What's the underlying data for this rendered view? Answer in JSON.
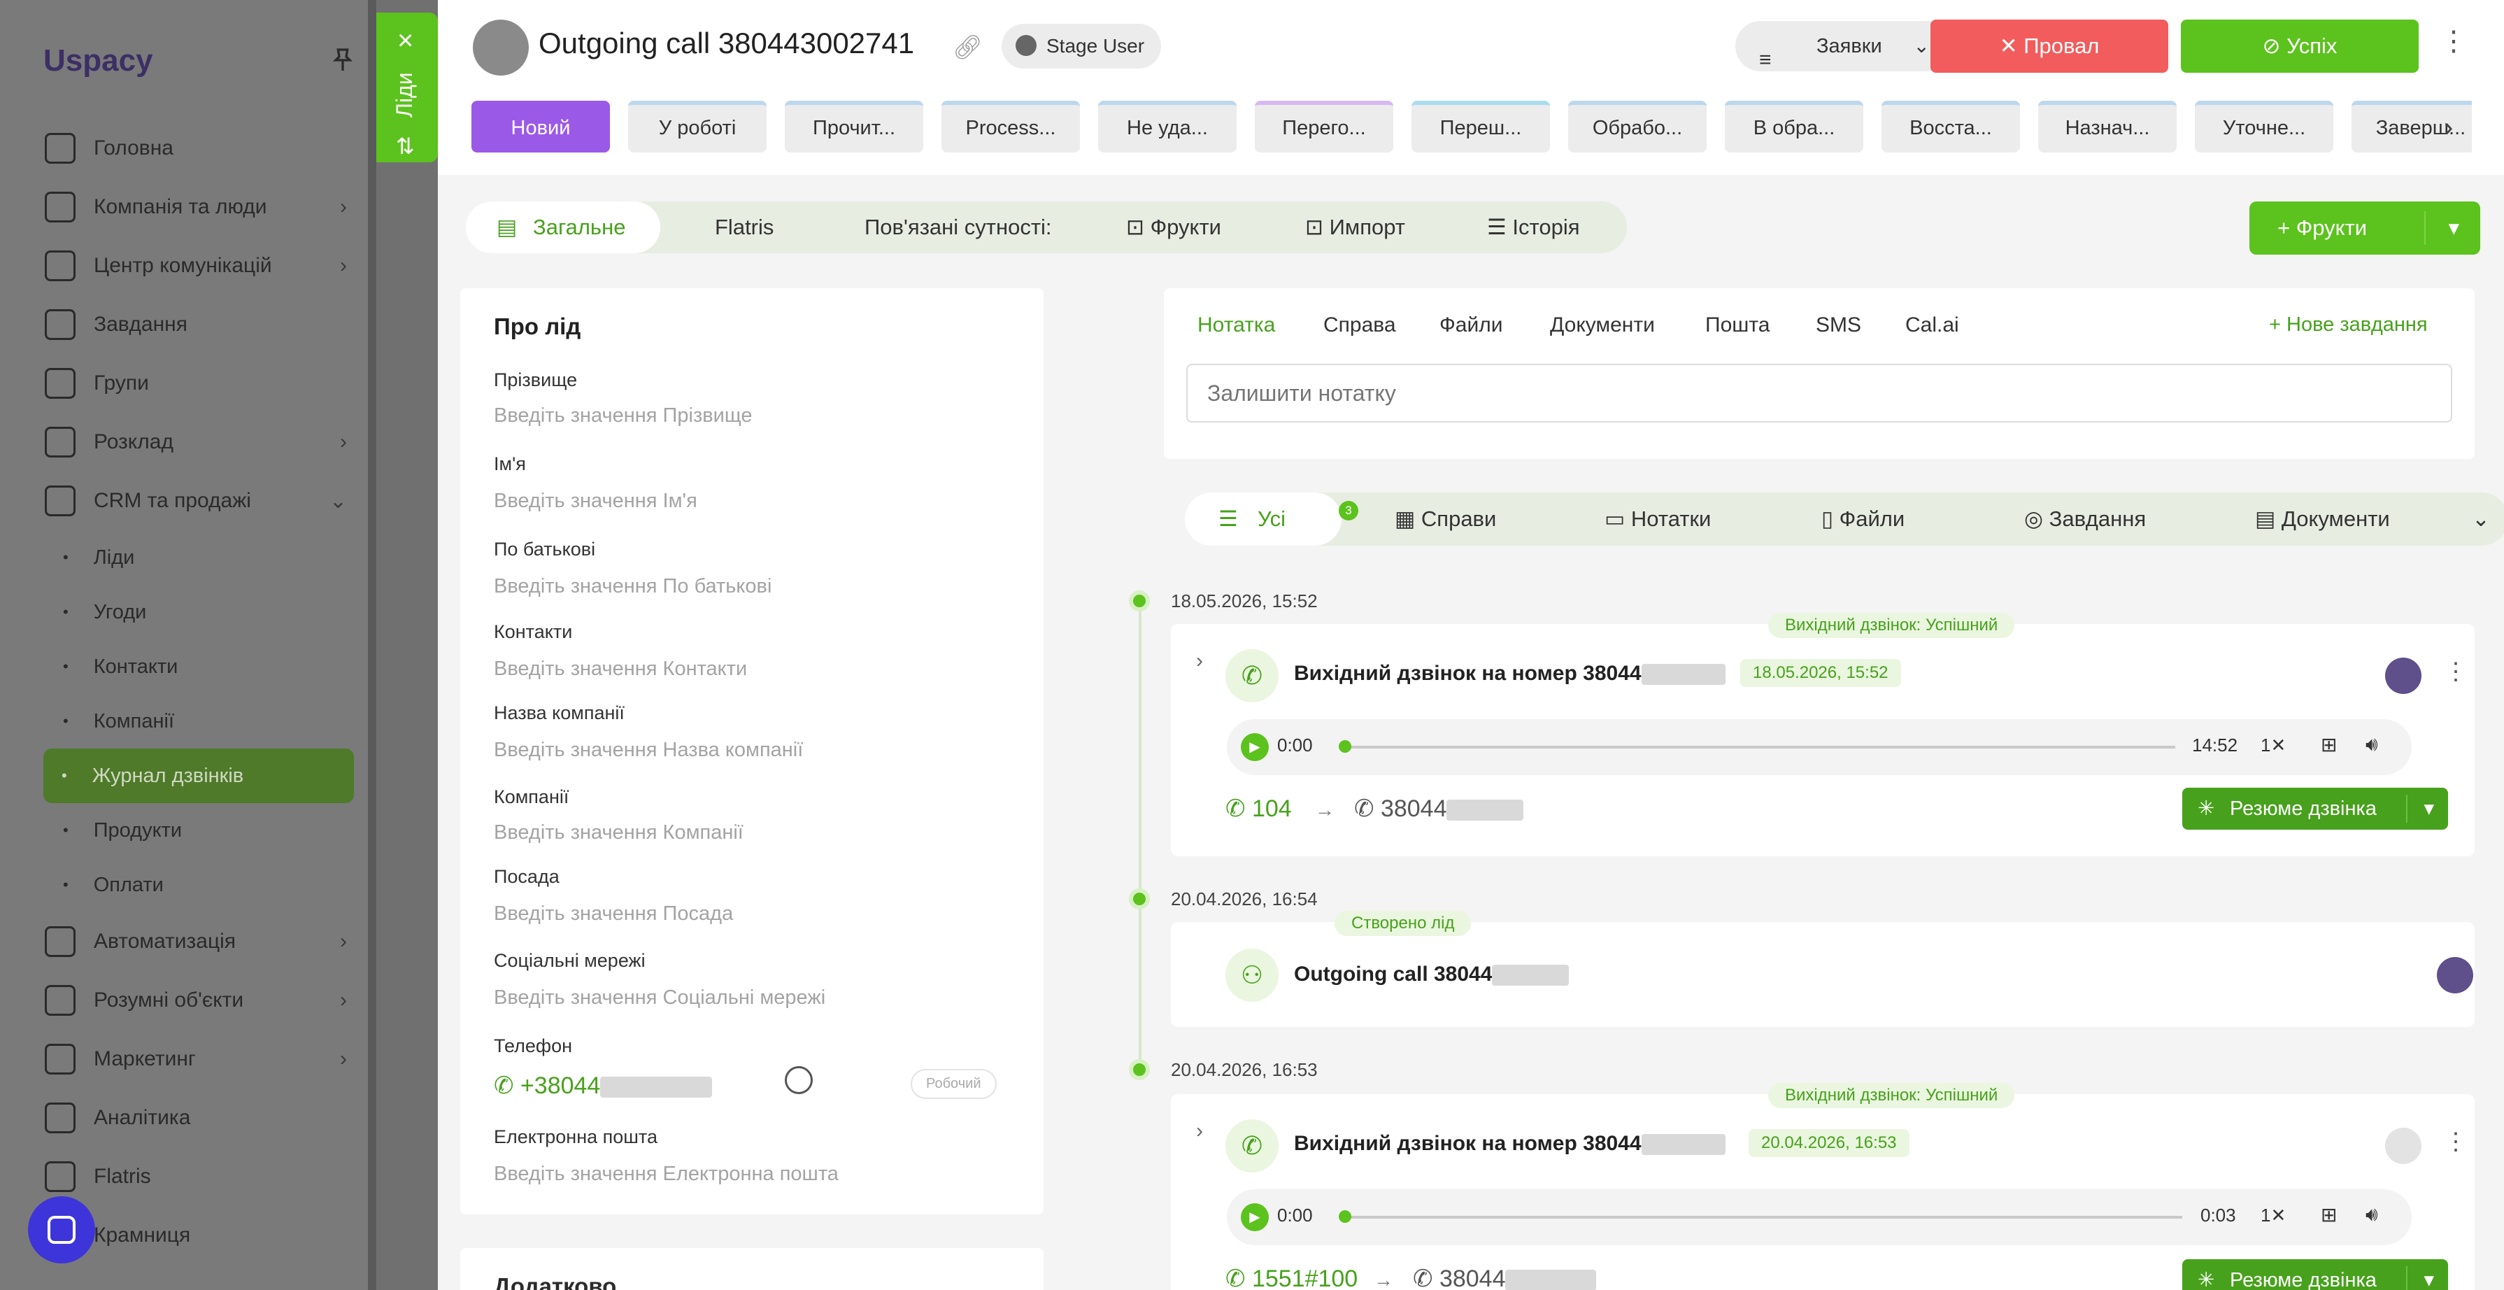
{
  "sidebar": {
    "logo": "Uspacy",
    "items": [
      {
        "label": "Головна",
        "icon": "home-icon",
        "chev": ""
      },
      {
        "label": "Компанія та люди",
        "icon": "company-icon",
        "chev": "›"
      },
      {
        "label": "Центр комунікацій",
        "icon": "chat-icon",
        "chev": "›"
      },
      {
        "label": "Завдання",
        "icon": "check-icon",
        "chev": ""
      },
      {
        "label": "Групи",
        "icon": "group-icon",
        "chev": ""
      },
      {
        "label": "Розклад",
        "icon": "calendar-icon",
        "chev": "›"
      },
      {
        "label": "CRM та продажі",
        "icon": "database-icon",
        "chev": "⌄"
      }
    ],
    "crm_subitems": [
      "Ліди",
      "Угоди",
      "Контакти",
      "Компанії",
      "Журнал дзвінків",
      "Продукти",
      "Оплати"
    ],
    "items_bottom": [
      {
        "label": "Автоматизація",
        "icon": "bolt-icon",
        "chev": "›"
      },
      {
        "label": "Розумні об'єкти",
        "icon": "smart-object-icon",
        "chev": "›"
      },
      {
        "label": "Маркетинг",
        "icon": "marketing-icon",
        "chev": "›"
      },
      {
        "label": "Аналітика",
        "icon": "analytics-icon",
        "chev": ""
      },
      {
        "label": "Flatris",
        "icon": "flatris-icon",
        "chev": ""
      },
      {
        "label": "Крамниця",
        "icon": "store-icon",
        "chev": ""
      }
    ]
  },
  "leads_tab": {
    "label": "Ліди",
    "close": "×"
  },
  "header": {
    "title": "Outgoing call 380443002741",
    "stage_user": "Stage User",
    "filter_label": "Заявки",
    "fail_label": "Провал",
    "success_label": "Успіх",
    "stages": [
      "Новий",
      "У роботі",
      "Прочит...",
      "Process...",
      "Не уда...",
      "Перего...",
      "Переш...",
      "Обрабо...",
      "В обра...",
      "Восста...",
      "Назнач...",
      "Уточне...",
      "Заверш..."
    ]
  },
  "tabs": {
    "general": "Загальне",
    "flatris": "Flatris",
    "related": "Пов'язані сутності:",
    "fruits": "Фрукти",
    "import": "Импорт",
    "history": "Історія",
    "add_fruits": "Фрукти"
  },
  "about": {
    "title": "Про лід",
    "fields": [
      {
        "label": "Прізвище",
        "placeholder": "Введіть значення Прізвище"
      },
      {
        "label": "Ім'я",
        "placeholder": "Введіть значення Ім'я"
      },
      {
        "label": "По батькові",
        "placeholder": "Введіть значення По батькові"
      },
      {
        "label": "Контакти",
        "placeholder": "Введіть значення Контакти"
      },
      {
        "label": "Назва компанії",
        "placeholder": "Введіть значення Назва компанії"
      },
      {
        "label": "Компанії",
        "placeholder": "Введіть значення Компанії"
      },
      {
        "label": "Посада",
        "placeholder": "Введіть значення Посада"
      },
      {
        "label": "Соціальні мережі",
        "placeholder": "Введіть значення Соціальні мережі"
      }
    ],
    "phone_label": "Телефон",
    "phone_value": "+38044",
    "phone_type": "Робочий",
    "email_label": "Електронна пошта",
    "email_placeholder": "Введіть значення Електронна пошта",
    "extra_title": "Додатково"
  },
  "note": {
    "tabs": [
      "Нотатка",
      "Справа",
      "Файли",
      "Документи",
      "Пошта",
      "SMS",
      "Cal.ai"
    ],
    "new_task": "Нове завдання",
    "placeholder": "Залишити нотатку"
  },
  "feed_filters": {
    "all": "Усі",
    "all_count": "3",
    "cases": "Справи",
    "notes": "Нотатки",
    "files": "Файли",
    "tasks": "Завдання",
    "docs": "Документи"
  },
  "timeline": [
    {
      "date": "18.05.2026, 15:52",
      "tag": "Вихідний дзвінок: Успішний",
      "title": "Вихідний дзвінок на номер 38044",
      "time": "18.05.2026, 15:52",
      "player_start": "0:00",
      "player_duration": "14:52",
      "speed": "1✕",
      "ext": "104",
      "callee": "38044",
      "resume": "Резюме дзвінка"
    },
    {
      "date": "20.04.2026, 16:54",
      "tag": "Створено лід",
      "title": "Outgoing call 38044"
    },
    {
      "date": "20.04.2026, 16:53",
      "tag": "Вихідний дзвінок: Успішний",
      "title": "Вихідний дзвінок на номер 38044",
      "time": "20.04.2026, 16:53",
      "player_start": "0:00",
      "player_duration": "0:03",
      "speed": "1✕",
      "ext": "1551#100",
      "callee": "38044",
      "resume": "Резюме дзвінка"
    }
  ],
  "colors": {
    "accent": "#5cc21d",
    "danger": "#f25c5c",
    "stage_current": "#9b59e8"
  }
}
